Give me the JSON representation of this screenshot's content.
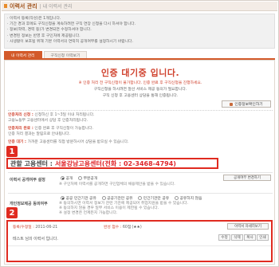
{
  "header": {
    "title": "이력서 관리",
    "subtitle": "| 내 이력서 관리"
  },
  "notices": [
    "· 이력서 등록(작성)은 1개입니다.",
    "· 기간 경과 후에도 구직신청을 계속하려면 구직 연장 신청을 다시 하셔야 합니다.",
    "· 이력서는 ",
    "· 정보(학력, 경력 등)가 변경되면 수정하셔야 합니다.",
    "· 변경된 정보는 반영 후 구인처에 제공됩니다.",
    "· 사생활이 보호될 위해 기본 이력서의 연락처 공개여부를 설정하시기 바랍니다."
  ],
  "tabs": [
    "내 이력서 관리",
    "구직신청 이력보기"
  ],
  "status": {
    "title": "인증 대기중 입니다.",
    "msg1": "※ 인증 처리 전 구직신청이 불가합니다. 인증 완료 후 구직신청을 진행하세요.",
    "msg2": "구직신청을 하시려면 알선 서비스 제공 동의가 필요합니다.",
    "msg3": "구직 신청 후 고용센터 상담을 통해 인증됩니다.",
    "cert_button": "인증정보확인하기"
  },
  "steps": [
    {
      "label": "인증처리 신청 : ",
      "text": "신청하신 후 1~3일 이내 처리됩니다.",
      "text2": "고용노동부 고용센터에서 상담 후 인증처리됩니다."
    },
    {
      "label": "인증처리 완료 : ",
      "text": "인증 완료 후 구직신청이 가능합니다.",
      "text2": "인증 처리 결과는 알림으로 안내됩니다."
    },
    {
      "label": "인증 대기 : ",
      "text": "가까운 고용센터를 직접 방문하시어 상담을 받으실 수 있습니다."
    }
  ],
  "badges": [
    "1",
    "2"
  ],
  "center": {
    "label": "관할 고용센터 :",
    "value": "서울강남고용센터(전화 : 02-3468-4794)"
  },
  "form": {
    "public_label": "이력서 공개여부 설정",
    "public_options": [
      "공개",
      "부분공개"
    ],
    "open_status_button": "공개여부 변경하기",
    "public_help": "※ 구인처에 이력서를 공개하면 구인업체의 채용제안을 받을 수 있습니다.",
    "consent_label": "개인정보제공 동의여부",
    "consent_options": [
      "공공 민간기관 공유",
      "공공기관만 공유",
      "민간기관만 공유",
      "공유하지 않음"
    ],
    "consent_help": "※ 동의하시면 이력서 정보가 관련 기관에 제공되어 취업지원을 받을 수 있습니다.",
    "consent_help2": "※ 동의하지 않을 경우 일부 서비스 이용이 제한될 수 있습니다.",
    "consent_help3": "※ 설정 변경은 언제든지 가능합니다."
  },
  "summary": {
    "reg_label": "등록/수정일 : ",
    "reg_date": "2011-06-21",
    "score_label": "완성 점수 : ",
    "score": "60점",
    "stars": "(★★)",
    "view_button": "이력서 자세히보기",
    "resume_name": "테스트 님의 이력서 입니다.",
    "actions": [
      "수정",
      "삭제",
      "복사",
      "인쇄"
    ]
  }
}
